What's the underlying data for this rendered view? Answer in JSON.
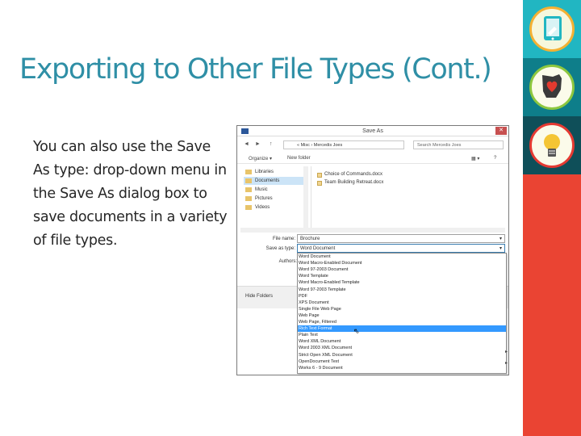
{
  "slide": {
    "title": "Exporting to Other File Types (Cont.)",
    "body": "You can also use the Save As type: drop-down menu in the Save As dialog box to save documents in a variety of file types."
  },
  "colors": {
    "title": "#2f8fa6",
    "sidebar_red": "#ea4433",
    "tile_teal": "#21b6c2",
    "tile_dark_teal": "#0e7e8a",
    "tile_darkest": "#0f4f59",
    "selection_blue": "#3399ff"
  },
  "sidebar": {
    "icons": [
      "tablet-touch-icon",
      "ohio-heart-icon",
      "lightbulb-icon"
    ]
  },
  "dialog": {
    "title": "Save As",
    "close_glyph": "✕",
    "nav_back": "◄",
    "nav_forward": "►",
    "nav_up": "↑",
    "address": "« Misc › Mercedis Joes",
    "search_placeholder": "Search Mercedis Joes",
    "toolbar": {
      "organize": "Organize ▾",
      "new_folder": "New folder"
    },
    "nav_items": [
      "Libraries",
      "Documents",
      "Music",
      "Pictures",
      "Videos"
    ],
    "files": [
      "Choice of Commands.docx",
      "Team Building Retreat.docx"
    ],
    "file_name_label": "File name:",
    "file_name_value": "Brochure",
    "save_type_label": "Save as type:",
    "save_type_value": "Word Document",
    "authors_label": "Authors:",
    "hide_folders": "Hide Folders",
    "dropdown_options": [
      "Word Document",
      "Word Macro-Enabled Document",
      "Word 97-2003 Document",
      "Word Template",
      "Word Macro-Enabled Template",
      "Word 97-2003 Template",
      "PDF",
      "XPS Document",
      "Single File Web Page",
      "Web Page",
      "Web Page, Filtered",
      "Rich Text Format",
      "Plain Text",
      "Word XML Document",
      "Word 2003 XML Document",
      "Strict Open XML Document",
      "OpenDocument Text",
      "Works 6 - 9 Document"
    ],
    "selected_option": "Rich Text Format"
  }
}
